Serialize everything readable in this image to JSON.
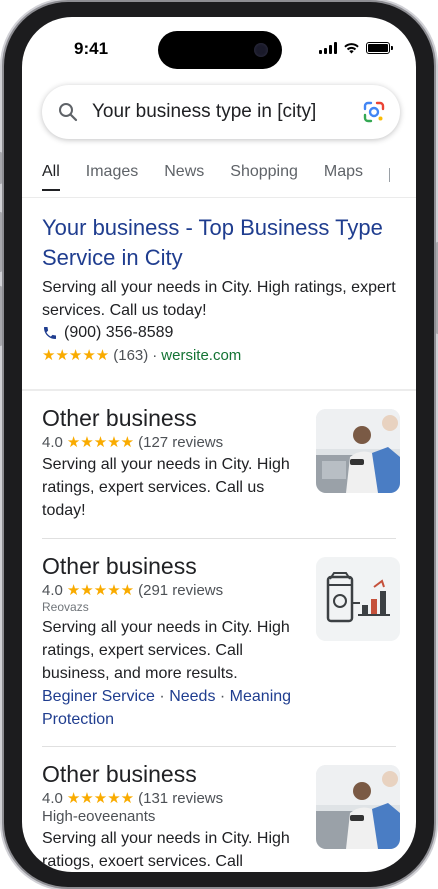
{
  "status_bar": {
    "time": "9:41"
  },
  "search": {
    "query": "Your business type in [city]"
  },
  "tabs": [
    {
      "label": "All",
      "active": true
    },
    {
      "label": "Images",
      "active": false
    },
    {
      "label": "News",
      "active": false
    },
    {
      "label": "Shopping",
      "active": false
    },
    {
      "label": "Maps",
      "active": false
    }
  ],
  "ad_result": {
    "title": "Your business - Top Business Type Service in City",
    "snippet": "Serving all your needs in City. High ratings, expert services. Call us today!",
    "phone": "(900) 356-8589",
    "stars": "★★★★★",
    "review_count": "(163)",
    "separator": "·",
    "site": "wersite.com"
  },
  "listings": [
    {
      "title": "Other business",
      "rating": "4.0",
      "stars": "★★★★★",
      "reviews": "(127 reviews",
      "snippet": "Serving all your needs in City. High ratings, expert services. Call us today!",
      "thumb_icon": "photo-person-icon"
    },
    {
      "title": "Other business",
      "rating": "4.0",
      "stars": "★★★★★",
      "reviews": "(291 reviews",
      "sublabel": "Reovazs",
      "snippet": "Serving all your needs in City. High ratings, expert services. Call business, and more results.",
      "links": [
        "Beginer Service",
        "Needs",
        "Meaning",
        "Protection"
      ],
      "thumb_icon": "storefront-illustration-icon"
    },
    {
      "title": "Other business",
      "rating": "4.0",
      "stars": "★★★★★",
      "reviews": "(131 reviews",
      "sublabel": "High-eoveenants",
      "snippet": "Serving all your needs in City. High ratiogs, exoert services. Call",
      "thumb_icon": "photo-person-icon"
    }
  ],
  "colors": {
    "link_blue": "#1f3d8f",
    "star_yellow": "#f9ab00",
    "site_green": "#137333"
  }
}
